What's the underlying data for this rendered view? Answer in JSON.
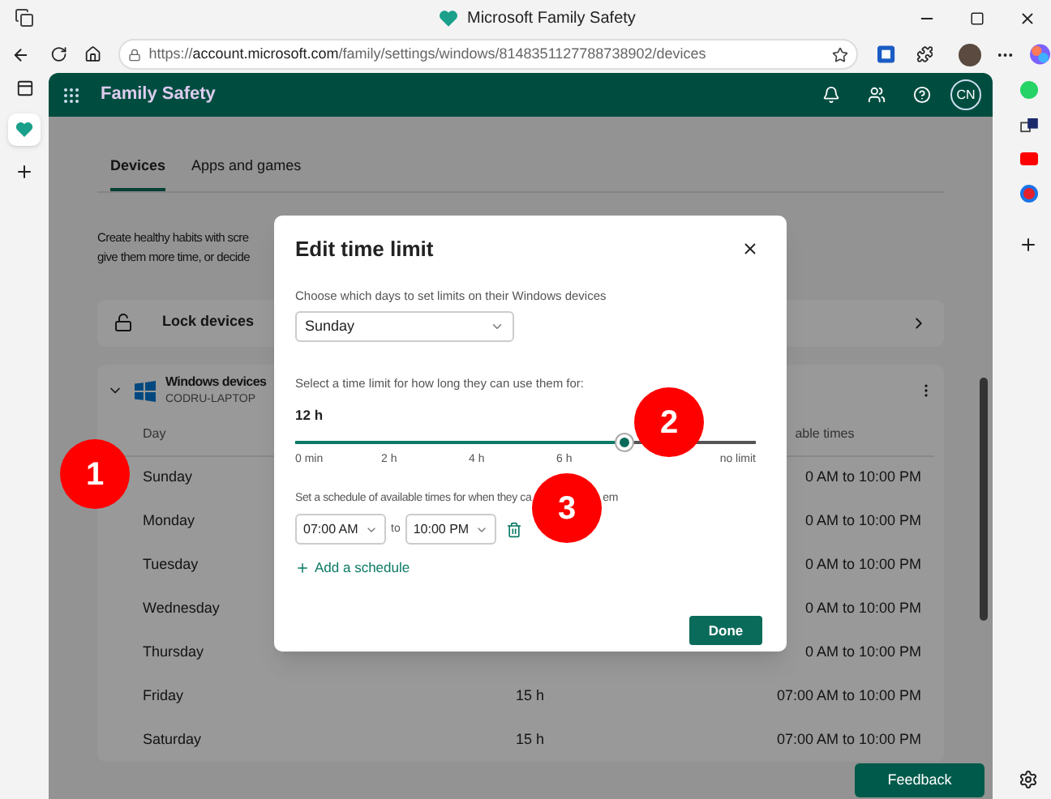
{
  "window": {
    "title": "Microsoft Family Safety"
  },
  "address_bar": {
    "url": "https://**account.microsoft.com**/family/settings/windows/8148351127788738902/devices"
  },
  "app_header": {
    "title": "Family Safety",
    "avatar_initials": "CN"
  },
  "tabs": [
    {
      "label": "Devices",
      "selected": true
    },
    {
      "label": "Apps and games",
      "selected": false
    }
  ],
  "description": [
    "Create healthy habits with scre",
    "give them more time, or decide"
  ],
  "lock_card": {
    "label": "Lock devices"
  },
  "device_card": {
    "title": "Windows devices",
    "subtitle": "CODRU-LAPTOP",
    "columns": [
      "Day",
      "able times"
    ],
    "rows": [
      {
        "day": "Sunday",
        "time_limit": "",
        "times": "0 AM to 10:00 PM"
      },
      {
        "day": "Monday",
        "time_limit": "",
        "times": "0 AM to 10:00 PM"
      },
      {
        "day": "Tuesday",
        "time_limit": "",
        "times": "0 AM to 10:00 PM"
      },
      {
        "day": "Wednesday",
        "time_limit": "",
        "times": "0 AM to 10:00 PM"
      },
      {
        "day": "Thursday",
        "time_limit": "",
        "times": "0 AM to 10:00 PM"
      },
      {
        "day": "Friday",
        "time_limit": "15 h",
        "times": "07:00 AM to 10:00 PM"
      },
      {
        "day": "Saturday",
        "time_limit": "15 h",
        "times": "07:00 AM to 10:00 PM"
      }
    ]
  },
  "dialog": {
    "title": "Edit time limit",
    "days_label": "Choose which days to set limits on their Windows devices",
    "day_select": "Sunday",
    "limit_label": "Select a time limit for how long they can use them for:",
    "limit_value": "12 h",
    "slider": {
      "level": 0.714,
      "ticks": [
        "0 min",
        "2 h",
        "4 h",
        "6 h",
        "no limit"
      ]
    },
    "schedule_label": "Set a schedule of available times for when they ca",
    "schedule_label_end": "em",
    "schedule": {
      "from": "07:00 AM",
      "separator": "to",
      "to": "10:00 PM"
    },
    "add_schedule": "Add a schedule",
    "done": "Done"
  },
  "feedback_button": "Feedback",
  "annotations": [
    "1",
    "2",
    "3"
  ]
}
